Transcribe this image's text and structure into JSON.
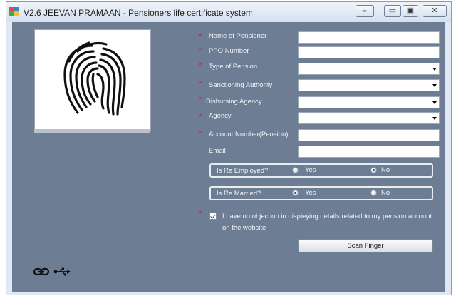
{
  "window": {
    "title": "V2.6 JEEVAN PRAMAAN - Pensioners life certificate system",
    "buttons": [
      {
        "name": "swap-window-button",
        "glyph": "⇔"
      },
      {
        "name": "minimize-button",
        "glyph": "▭"
      },
      {
        "name": "maximize-button",
        "glyph": "▣"
      },
      {
        "name": "close-button",
        "glyph": "✕"
      }
    ]
  },
  "form": {
    "required_marker": "*",
    "fields": [
      {
        "label": "Name of Pensioner",
        "value": "",
        "type": "text",
        "required": true
      },
      {
        "label": "PPO Number",
        "value": "",
        "type": "text",
        "required": true
      },
      {
        "label": "Type of Pension",
        "value": "",
        "type": "dropdown",
        "required": true
      },
      {
        "label": "Sanctioning Authority",
        "value": "",
        "type": "dropdown",
        "required": true
      },
      {
        "label": "Disbursing Agency",
        "value": "",
        "type": "dropdown",
        "required": true
      },
      {
        "label": "Agency",
        "value": "",
        "type": "dropdown",
        "required": true
      },
      {
        "label": "Account Number(Pension)",
        "value": "",
        "type": "text",
        "required": true
      },
      {
        "label": "Email",
        "value": "",
        "type": "text",
        "required": false
      }
    ],
    "re_employed": {
      "label": "Is Re Employed?",
      "yes_label": "Yes",
      "no_label": "No",
      "selected": "No"
    },
    "re_married": {
      "label": "Is Re Married?",
      "yes_label": "Yes",
      "no_label": "No",
      "selected": "Yes"
    },
    "consent": {
      "text": "I have no objection in displeying details related to my pension account on the website",
      "checked": true
    },
    "scan_button_label": "Scan Finger"
  },
  "status_icons": [
    "link-icon",
    "usb-icon"
  ],
  "colors": {
    "client_bg": "#6d7d94",
    "required": "#e02020",
    "label_text": "#f1f4f8"
  }
}
